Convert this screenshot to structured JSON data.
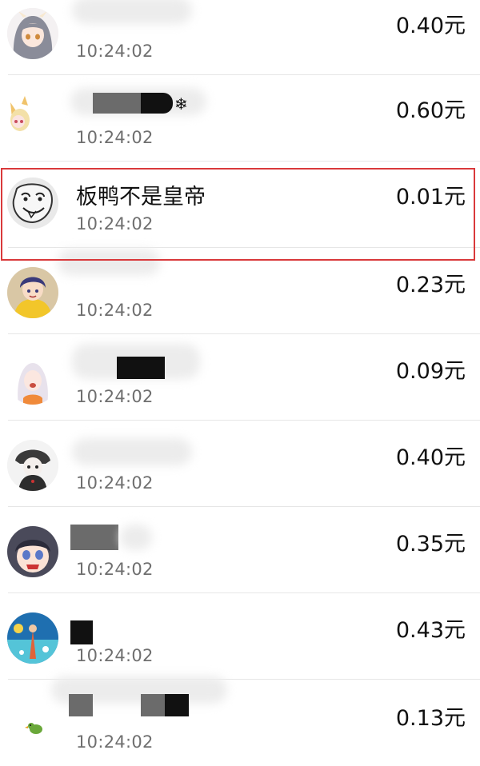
{
  "records": [
    {
      "name": "",
      "time": "10:24:02",
      "amount": "0.40元",
      "avatar_icon": "anime-girl-gray-hair-avatar"
    },
    {
      "name": "",
      "time": "10:24:02",
      "amount": "0.60元",
      "avatar_icon": "anime-fox-girl-avatar"
    },
    {
      "name": "板鸭不是皇帝",
      "time": "10:24:02",
      "amount": "0.01元",
      "avatar_icon": "doodle-sketch-avatar"
    },
    {
      "name": "",
      "time": "10:24:02",
      "amount": "0.23元",
      "avatar_icon": "anime-boy-yellow-hoodie-avatar"
    },
    {
      "name": "",
      "time": "10:24:02",
      "amount": "0.09元",
      "avatar_icon": "anime-girl-white-hair-avatar"
    },
    {
      "name": "",
      "time": "10:24:02",
      "amount": "0.40元",
      "avatar_icon": "anime-character-monochrome-avatar"
    },
    {
      "name": "",
      "time": "10:24:02",
      "amount": "0.35元",
      "avatar_icon": "anime-girl-crying-avatar"
    },
    {
      "name": "",
      "time": "10:24:02",
      "amount": "0.43元",
      "avatar_icon": "colorful-fantasy-avatar"
    },
    {
      "name": "",
      "time": "10:24:02",
      "amount": "0.13元",
      "avatar_icon": "small-green-bird-avatar"
    }
  ],
  "colors": {
    "highlight": "#d9393b",
    "time_text": "#6f6f6f",
    "divider": "#e6e6e6"
  }
}
